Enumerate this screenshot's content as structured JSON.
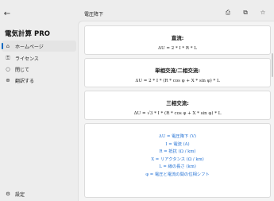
{
  "app": {
    "title": "電気計算 PRO"
  },
  "sidebar": {
    "back_icon": "←",
    "items": [
      {
        "label": "ホームページ",
        "icon": "home-icon",
        "glyph": "⌂",
        "active": true
      },
      {
        "label": "ライセンス",
        "icon": "key-icon",
        "glyph": "⚿",
        "active": false
      },
      {
        "label": "閉じて",
        "icon": "circle-icon",
        "glyph": "○",
        "active": false
      },
      {
        "label": "翻訳する",
        "icon": "globe-icon",
        "glyph": "⊕",
        "active": false
      }
    ],
    "settings": {
      "label": "設定",
      "icon": "gear-icon",
      "glyph": "⚙"
    }
  },
  "header": {
    "title": "電圧降下",
    "icons": {
      "print": "⎙",
      "share": "⧉",
      "star": "☆"
    }
  },
  "cards": [
    {
      "title": "直流:",
      "formula": "ΔU = 2 * I * R * L"
    },
    {
      "title": "単相交流/二相交流:",
      "formula": "ΔU = 2 * I * (R * cos φ + X * sin φ) * L"
    },
    {
      "title": "三相交流:",
      "formula": "ΔU = √3 * I * (R * cos φ + X * sin φ) * L"
    }
  ],
  "legend": [
    "ΔU = 電圧降下 (V)",
    "I = 電流 (A)",
    "R = 抵抗 (Ω / km)",
    "X = リアクタンス (Ω / km)",
    "L = 線の長さ (km)",
    "φ = 電圧と電流の間の位相シフト"
  ],
  "colors": {
    "accent": "#0067c0",
    "legend_text": "#1f6fd4"
  }
}
